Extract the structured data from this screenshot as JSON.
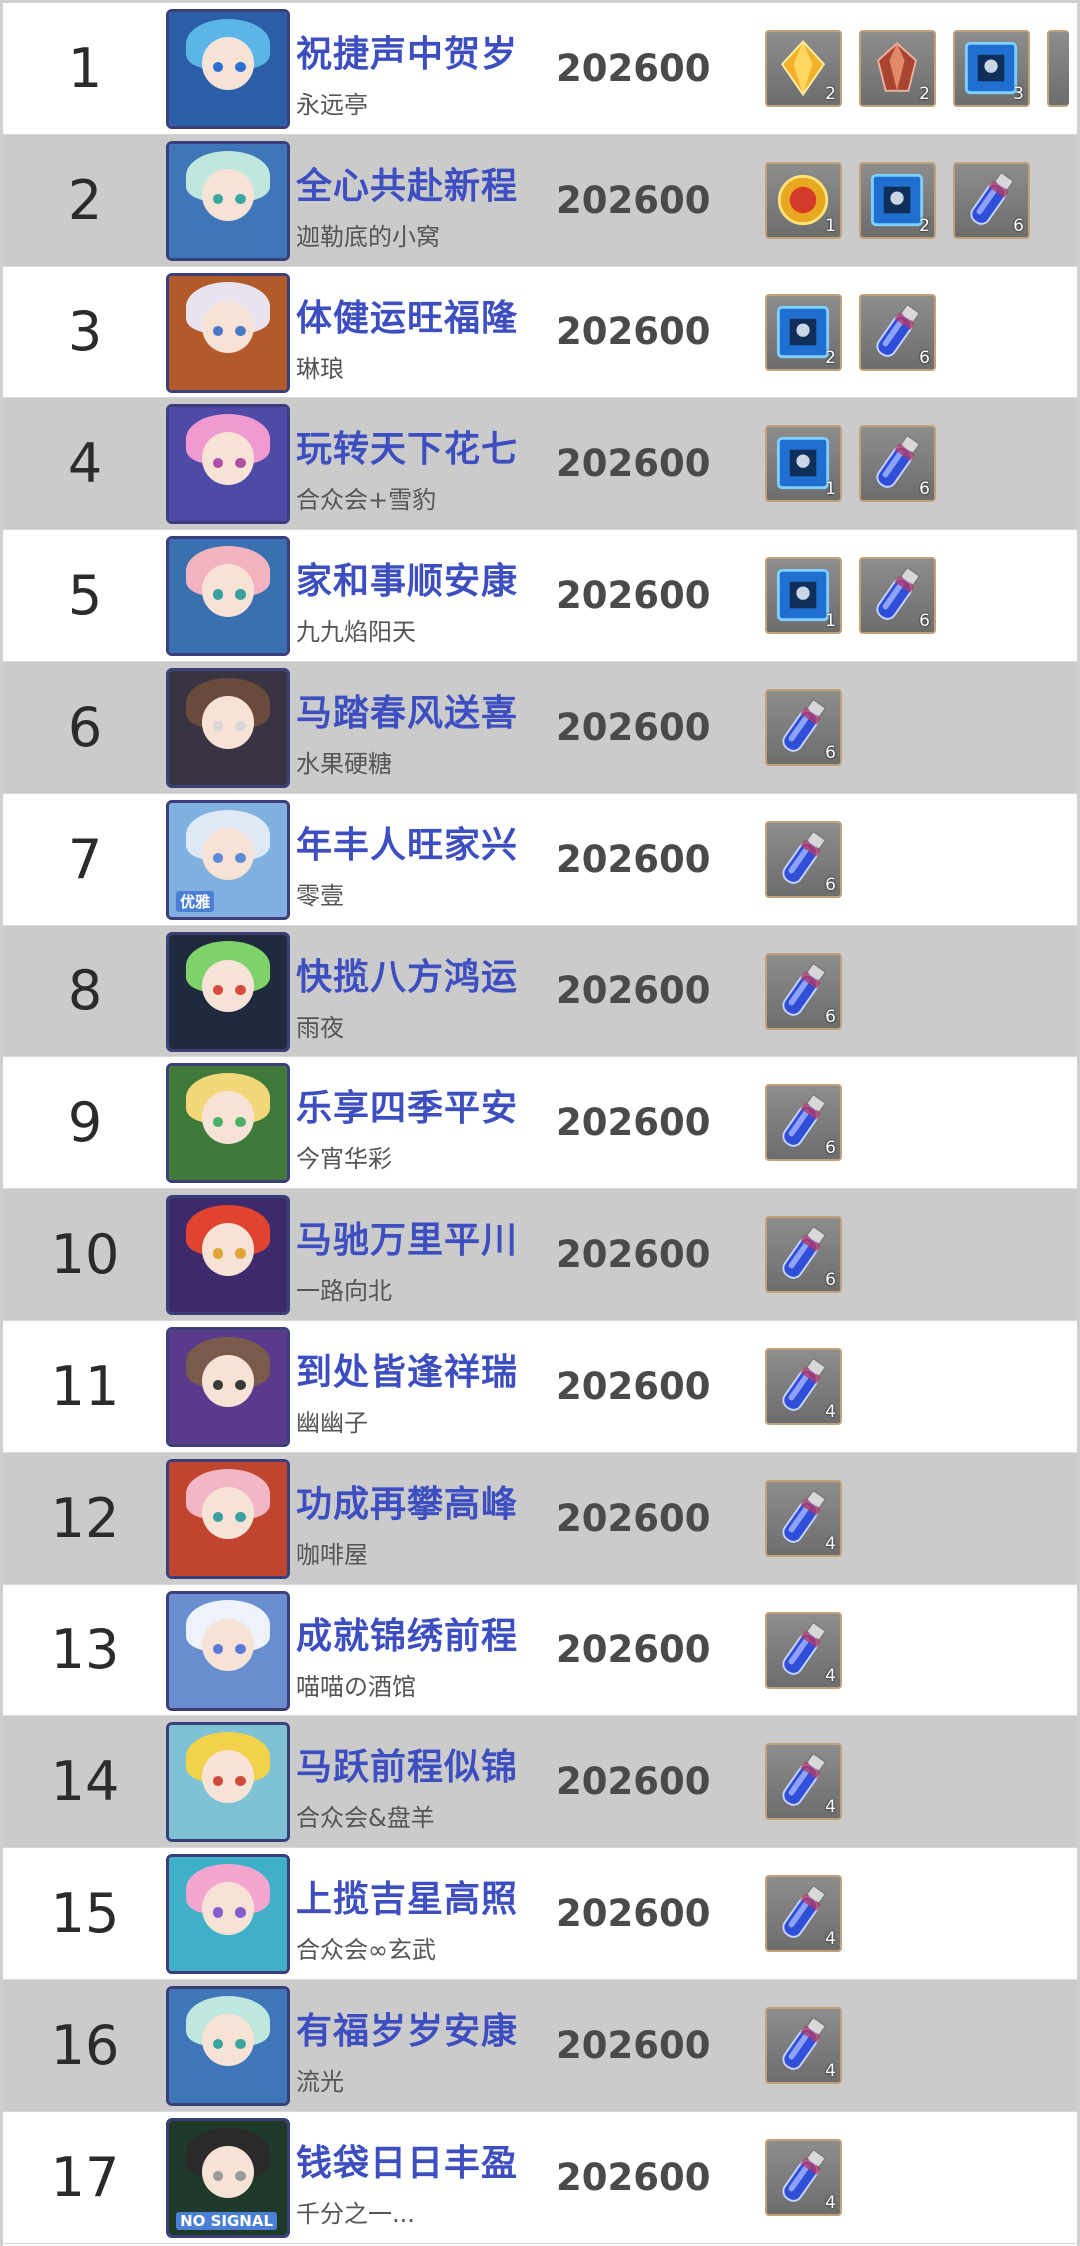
{
  "leaderboard": {
    "rows": [
      {
        "rank": "1",
        "title": "祝捷声中贺岁",
        "guild": "永远亭",
        "score": "202600",
        "avatar": {
          "bg": "#2d5fa8",
          "hair": "#5bb5e6",
          "eye": "#2a6fd1",
          "tag": ""
        },
        "rewards": [
          {
            "icon": "gold-crystal-icon",
            "count": "2"
          },
          {
            "icon": "red-crystal-icon",
            "count": "2"
          },
          {
            "icon": "blue-card-icon",
            "count": "3"
          }
        ],
        "overflow": true
      },
      {
        "rank": "2",
        "title": "全心共赴新程",
        "guild": "迦勒底的小窝",
        "score": "202600",
        "avatar": {
          "bg": "#3f76b8",
          "hair": "#bfe7e0",
          "eye": "#3aa6a0",
          "tag": ""
        },
        "rewards": [
          {
            "icon": "gold-coin-icon",
            "count": "1"
          },
          {
            "icon": "blue-card-icon",
            "count": "2"
          },
          {
            "icon": "blue-vial-icon",
            "count": "6"
          }
        ],
        "overflow": false
      },
      {
        "rank": "3",
        "title": "体健运旺福隆",
        "guild": "琳琅",
        "score": "202600",
        "avatar": {
          "bg": "#b35a2a",
          "hair": "#e8e3ee",
          "eye": "#4a77c8",
          "tag": ""
        },
        "rewards": [
          {
            "icon": "blue-card-icon",
            "count": "2"
          },
          {
            "icon": "blue-vial-icon",
            "count": "6"
          }
        ],
        "overflow": false
      },
      {
        "rank": "4",
        "title": "玩转天下花七",
        "guild": "合众会+雪豹",
        "score": "202600",
        "avatar": {
          "bg": "#4f4aa8",
          "hair": "#f09ad1",
          "eye": "#b04fa8",
          "tag": ""
        },
        "rewards": [
          {
            "icon": "blue-card-icon",
            "count": "1"
          },
          {
            "icon": "blue-vial-icon",
            "count": "6"
          }
        ],
        "overflow": false
      },
      {
        "rank": "5",
        "title": "家和事顺安康",
        "guild": "九九焰阳天",
        "score": "202600",
        "avatar": {
          "bg": "#3a6fb0",
          "hair": "#f2b2c0",
          "eye": "#3aa0a0",
          "tag": ""
        },
        "rewards": [
          {
            "icon": "blue-card-icon",
            "count": "1"
          },
          {
            "icon": "blue-vial-icon",
            "count": "6"
          }
        ],
        "overflow": false
      },
      {
        "rank": "6",
        "title": "马踏春风送喜",
        "guild": "水果硬糖",
        "score": "202600",
        "avatar": {
          "bg": "#3a3342",
          "hair": "#6a4a3a",
          "eye": "#d7d7d7",
          "tag": ""
        },
        "rewards": [
          {
            "icon": "blue-vial-icon",
            "count": "6"
          }
        ],
        "overflow": false
      },
      {
        "rank": "7",
        "title": "年丰人旺家兴",
        "guild": "零壹",
        "score": "202600",
        "avatar": {
          "bg": "#7fb0e0",
          "hair": "#dfe9f6",
          "eye": "#5a8ad8",
          "tag": "优雅"
        },
        "rewards": [
          {
            "icon": "blue-vial-icon",
            "count": "6"
          }
        ],
        "overflow": false
      },
      {
        "rank": "8",
        "title": "快揽八方鸿运",
        "guild": "雨夜",
        "score": "202600",
        "avatar": {
          "bg": "#1f2a3f",
          "hair": "#7fd36a",
          "eye": "#d84a3a",
          "tag": ""
        },
        "rewards": [
          {
            "icon": "blue-vial-icon",
            "count": "6"
          }
        ],
        "overflow": false
      },
      {
        "rank": "9",
        "title": "乐享四季平安",
        "guild": "今宵华彩",
        "score": "202600",
        "avatar": {
          "bg": "#3f7a3a",
          "hair": "#f2d77a",
          "eye": "#4ab06a",
          "tag": ""
        },
        "rewards": [
          {
            "icon": "blue-vial-icon",
            "count": "6"
          }
        ],
        "overflow": false
      },
      {
        "rank": "10",
        "title": "马驰万里平川",
        "guild": "一路向北",
        "score": "202600",
        "avatar": {
          "bg": "#3d2a6a",
          "hair": "#e0432f",
          "eye": "#e0a53a",
          "tag": ""
        },
        "rewards": [
          {
            "icon": "blue-vial-icon",
            "count": "6"
          }
        ],
        "overflow": false
      },
      {
        "rank": "11",
        "title": "到处皆逢祥瑞",
        "guild": "幽幽子",
        "score": "202600",
        "avatar": {
          "bg": "#5a3a8a",
          "hair": "#7a5a4a",
          "eye": "#3a3a3a",
          "tag": ""
        },
        "rewards": [
          {
            "icon": "blue-vial-icon",
            "count": "4"
          }
        ],
        "overflow": false
      },
      {
        "rank": "12",
        "title": "功成再攀高峰",
        "guild": "咖啡屋",
        "score": "202600",
        "avatar": {
          "bg": "#c0452f",
          "hair": "#f2b6c4",
          "eye": "#3aa0a0",
          "tag": ""
        },
        "rewards": [
          {
            "icon": "blue-vial-icon",
            "count": "4"
          }
        ],
        "overflow": false
      },
      {
        "rank": "13",
        "title": "成就锦绣前程",
        "guild": "喵喵の酒馆",
        "score": "202600",
        "avatar": {
          "bg": "#6a8fd0",
          "hair": "#eef2fa",
          "eye": "#5a7ad8",
          "tag": ""
        },
        "rewards": [
          {
            "icon": "blue-vial-icon",
            "count": "4"
          }
        ],
        "overflow": false
      },
      {
        "rank": "14",
        "title": "马跃前程似锦",
        "guild": "合众会&盘羊",
        "score": "202600",
        "avatar": {
          "bg": "#7fc2d6",
          "hair": "#f2d24a",
          "eye": "#d04a3a",
          "tag": ""
        },
        "rewards": [
          {
            "icon": "blue-vial-icon",
            "count": "4"
          }
        ],
        "overflow": false
      },
      {
        "rank": "15",
        "title": "上揽吉星高照",
        "guild": "合众会∞玄武",
        "score": "202600",
        "avatar": {
          "bg": "#3fb0c8",
          "hair": "#f5a6d0",
          "eye": "#8a5ad0",
          "tag": ""
        },
        "rewards": [
          {
            "icon": "blue-vial-icon",
            "count": "4"
          }
        ],
        "overflow": false
      },
      {
        "rank": "16",
        "title": "有福岁岁安康",
        "guild": "流光",
        "score": "202600",
        "avatar": {
          "bg": "#3f76b8",
          "hair": "#bfe7e0",
          "eye": "#3aa6a0",
          "tag": ""
        },
        "rewards": [
          {
            "icon": "blue-vial-icon",
            "count": "4"
          }
        ],
        "overflow": false
      },
      {
        "rank": "17",
        "title": "钱袋日日丰盈",
        "guild": "千分之一...",
        "score": "202600",
        "avatar": {
          "bg": "#1f3a2a",
          "hair": "#2a2a2a",
          "eye": "#9a9a9a",
          "tag": "NO SIGNAL"
        },
        "rewards": [
          {
            "icon": "blue-vial-icon",
            "count": "4"
          }
        ],
        "overflow": false
      }
    ]
  },
  "colors": {
    "title": "#3d4fc0",
    "score": "#4a4a4a",
    "row_alt": "#cbcbcb",
    "row_base": "#ffffff",
    "item_border": "#c4a07a"
  }
}
